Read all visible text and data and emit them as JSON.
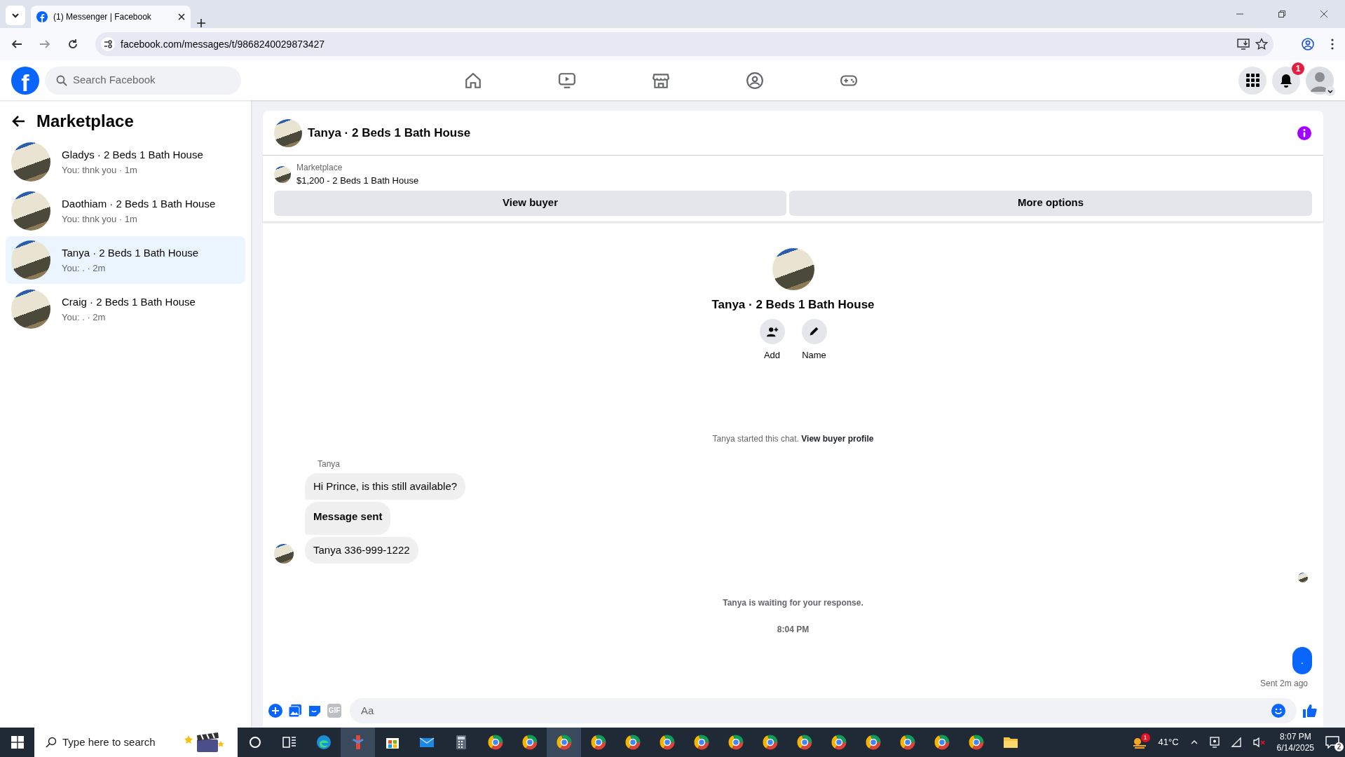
{
  "browser": {
    "tab_title": "(1) Messenger | Facebook",
    "url": "facebook.com/messages/t/9868240029873427"
  },
  "topbar": {
    "logo": "f",
    "search_placeholder": "Search Facebook",
    "notification_count": "1"
  },
  "sidebar": {
    "title": "Marketplace",
    "conversations": [
      {
        "name": "Gladys · 2 Beds 1 Bath House",
        "preview": "You: thnk you · 1m",
        "selected": false
      },
      {
        "name": "Daothiam · 2 Beds 1 Bath House",
        "preview": "You: thnk you · 1m",
        "selected": false
      },
      {
        "name": "Tanya · 2 Beds 1 Bath House",
        "preview": "You: . · 2m",
        "selected": true
      },
      {
        "name": "Craig · 2 Beds 1 Bath House",
        "preview": "You: . · 2m",
        "selected": false
      }
    ]
  },
  "chat": {
    "title": "Tanya · 2 Beds 1 Bath House",
    "listing": {
      "source": "Marketplace",
      "item": "$1,200 - 2 Beds 1 Bath House"
    },
    "buttons": [
      "View buyer",
      "More options"
    ],
    "profile": {
      "name": "Tanya · 2 Beds 1 Bath House",
      "actions": [
        {
          "kind": "add",
          "label": "Add"
        },
        {
          "kind": "edit",
          "label": "Name"
        }
      ]
    },
    "notice": {
      "text": "Tanya started this chat.",
      "link": "View buyer profile"
    },
    "sender": "Tanya",
    "messages": [
      {
        "text": "Hi Prince, is this still available?",
        "bold": false,
        "avatar": false
      },
      {
        "text": "Message sent",
        "bold": true,
        "avatar": false
      },
      {
        "text": "Tanya 336-999-1222",
        "bold": false,
        "avatar": true
      }
    ],
    "waiting": "Tanya is waiting for your response.",
    "time": "8:04 PM",
    "outgoing": [
      {
        "text": "."
      }
    ],
    "sent_status": "Sent 2m ago",
    "composer": {
      "placeholder": "Aa",
      "gif_label": "GIF"
    }
  },
  "taskbar": {
    "search_placeholder": "Type here to search",
    "weather_badge": "1",
    "temperature": "41°C",
    "time": "8:07 PM",
    "date": "6/14/2025",
    "notifications": "2"
  }
}
